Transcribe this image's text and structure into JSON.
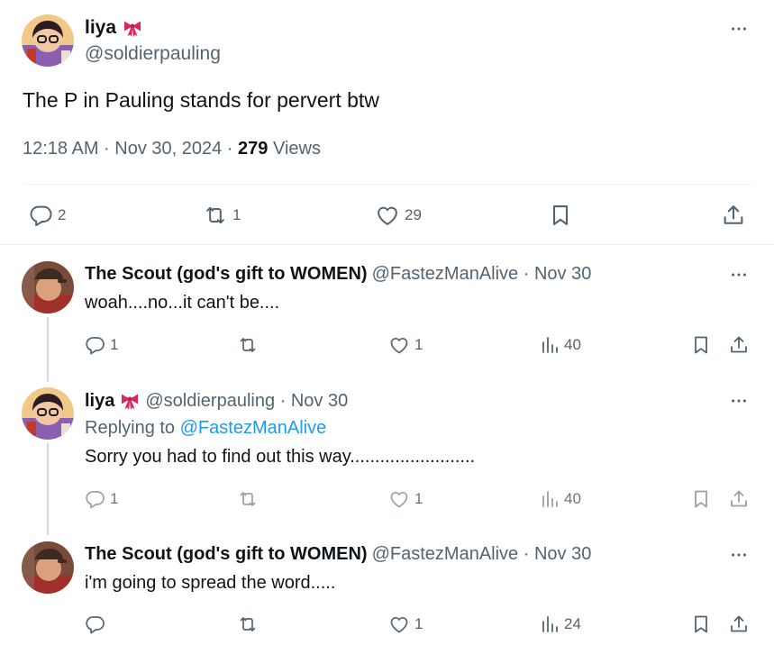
{
  "colors": {
    "text": "#0f1419",
    "secondary": "#536471",
    "link": "#1d9bf0",
    "divider": "#eff3f4",
    "thread": "#cfd9de",
    "bow": "#e0245e"
  },
  "main_tweet": {
    "name": "liya",
    "name_emoji": "bow-icon",
    "handle": "@soldierpauling",
    "text": "The P in Pauling stands for pervert btw",
    "time": "12:18 AM · Nov 30, 2024 · ",
    "views_count": "279",
    "views_label": " Views",
    "actions": {
      "replies": "2",
      "reposts": "1",
      "likes": "29"
    }
  },
  "replies": [
    {
      "name": "The Scout (god's gift to WOMEN)",
      "handle": "@FastezManAlive · Nov 30",
      "text": "woah....no...it can't be....",
      "actions": {
        "replies": "1",
        "reposts": "",
        "likes": "1",
        "views": "40"
      }
    },
    {
      "name": "liya",
      "handle": "@soldierpauling · Nov 30",
      "replying_prefix": "Replying to ",
      "replying_to": "@FastezManAlive",
      "text": "Sorry you had to find out this way.........................",
      "actions": {
        "replies": "1",
        "reposts": "",
        "likes": "1",
        "views": "40"
      }
    },
    {
      "name": "The Scout (god's gift to WOMEN)",
      "handle": "@FastezManAlive · Nov 30",
      "text": "i'm going to spread the word.....",
      "actions": {
        "replies": "",
        "reposts": "",
        "likes": "1",
        "views": "24"
      }
    }
  ]
}
